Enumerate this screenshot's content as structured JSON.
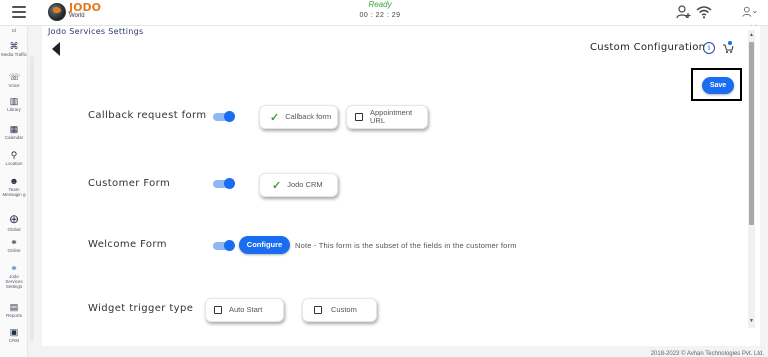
{
  "topbar": {
    "logo_name": "JODO",
    "logo_sub": "World",
    "status": "Ready",
    "timer": "00 : 22 : 29",
    "icons": [
      "menu-icon",
      "add-user-icon",
      "wifi-icon",
      "user-icon"
    ]
  },
  "sidebar": {
    "items": [
      {
        "label": "Id",
        "icon": "id-icon"
      },
      {
        "label": "Media Traffic",
        "icon": "media-traffic-icon"
      },
      {
        "label": "Voice",
        "icon": "phone-icon"
      },
      {
        "label": "Library",
        "icon": "library-icon"
      },
      {
        "label": "Calendar",
        "icon": "calendar-icon"
      },
      {
        "label": "Location",
        "icon": "location-icon"
      },
      {
        "label": "Team Messagin g",
        "icon": "team-icon"
      },
      {
        "label": "Global",
        "icon": "globe-icon"
      },
      {
        "label": "Online",
        "icon": "online-icon"
      },
      {
        "label": "Jodo Services Settings",
        "icon": "services-icon"
      },
      {
        "label": "Reports",
        "icon": "reports-icon"
      },
      {
        "label": "CRM",
        "icon": "crm-icon"
      }
    ]
  },
  "main": {
    "page_title": "Jodo Services Settings",
    "custom_config": "Custom Configuration",
    "save_label": "Save",
    "rows": {
      "callback": {
        "label": "Callback request form",
        "toggle_on": true,
        "options": [
          {
            "label": "Callback form",
            "checked": true
          },
          {
            "label": "Appointment URL",
            "checked": false
          }
        ]
      },
      "customer": {
        "label": "Customer Form",
        "toggle_on": true,
        "options": [
          {
            "label": "Jodo CRM",
            "checked": true
          }
        ]
      },
      "welcome": {
        "label": "Welcome Form",
        "toggle_on": true,
        "configure_label": "Configure",
        "note": "Note - This form is the subset of the fields in the customer form"
      },
      "widget": {
        "label": "Widget trigger type",
        "options": [
          {
            "label": "Auto Start",
            "checked": false
          },
          {
            "label": "Custom",
            "checked": false
          }
        ]
      }
    }
  },
  "footer": "2018-2023 © Avhan Technologies Pvt. Ltd.",
  "colors": {
    "accent": "#1a6cf0",
    "check": "#3aa33a",
    "brand": "#e07b1f"
  }
}
